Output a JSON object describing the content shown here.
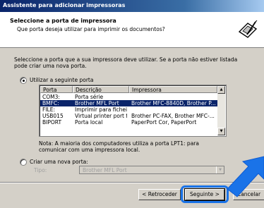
{
  "window": {
    "title": "Assistente para adicionar impressoras",
    "header_title": "Seleccione a porta de impressora",
    "header_subtitle": "Que porta deseja utilizar para imprimir os documentos?",
    "header_icon": "printer-wizard-icon"
  },
  "intro_text": "Seleccione a porta que a sua impressora deve utilizar. Se a porta não estiver listada pode criar uma nova porta.",
  "use_port": {
    "label": "Utilizar a seguinte porta",
    "checked": true
  },
  "port_list": {
    "columns": [
      "Porta",
      "Descrição",
      "Impressora"
    ],
    "rows": [
      [
        "COM3:",
        "Porta série",
        ""
      ],
      [
        "BMFC:",
        "Brother MFL Port",
        "Brother MFC-8840D, Brother P..."
      ],
      [
        "FILE:",
        "Imprimir para ficheiro",
        ""
      ],
      [
        "USB015",
        "Virtual printer port for ...",
        "Brother PC-FAX, Brother MFC-..."
      ],
      [
        "BIPORT",
        "Porta local",
        "PaperPort Cor, PaperPort"
      ]
    ],
    "selected_index": 1
  },
  "note_text": "Nota: A maioria dos computadores utiliza a porta LPT1: para comunicar com uma impressora local.",
  "create_port": {
    "label": "Criar uma nova porta:",
    "checked": false,
    "type_label": "Tipo:",
    "type_value": "Brother MFL Port"
  },
  "buttons": {
    "back": "< Retroceder",
    "next": "Seguinte >",
    "cancel": "Cancelar"
  },
  "colors": {
    "highlight": "#1a73e8",
    "selection": "#0a246a"
  }
}
